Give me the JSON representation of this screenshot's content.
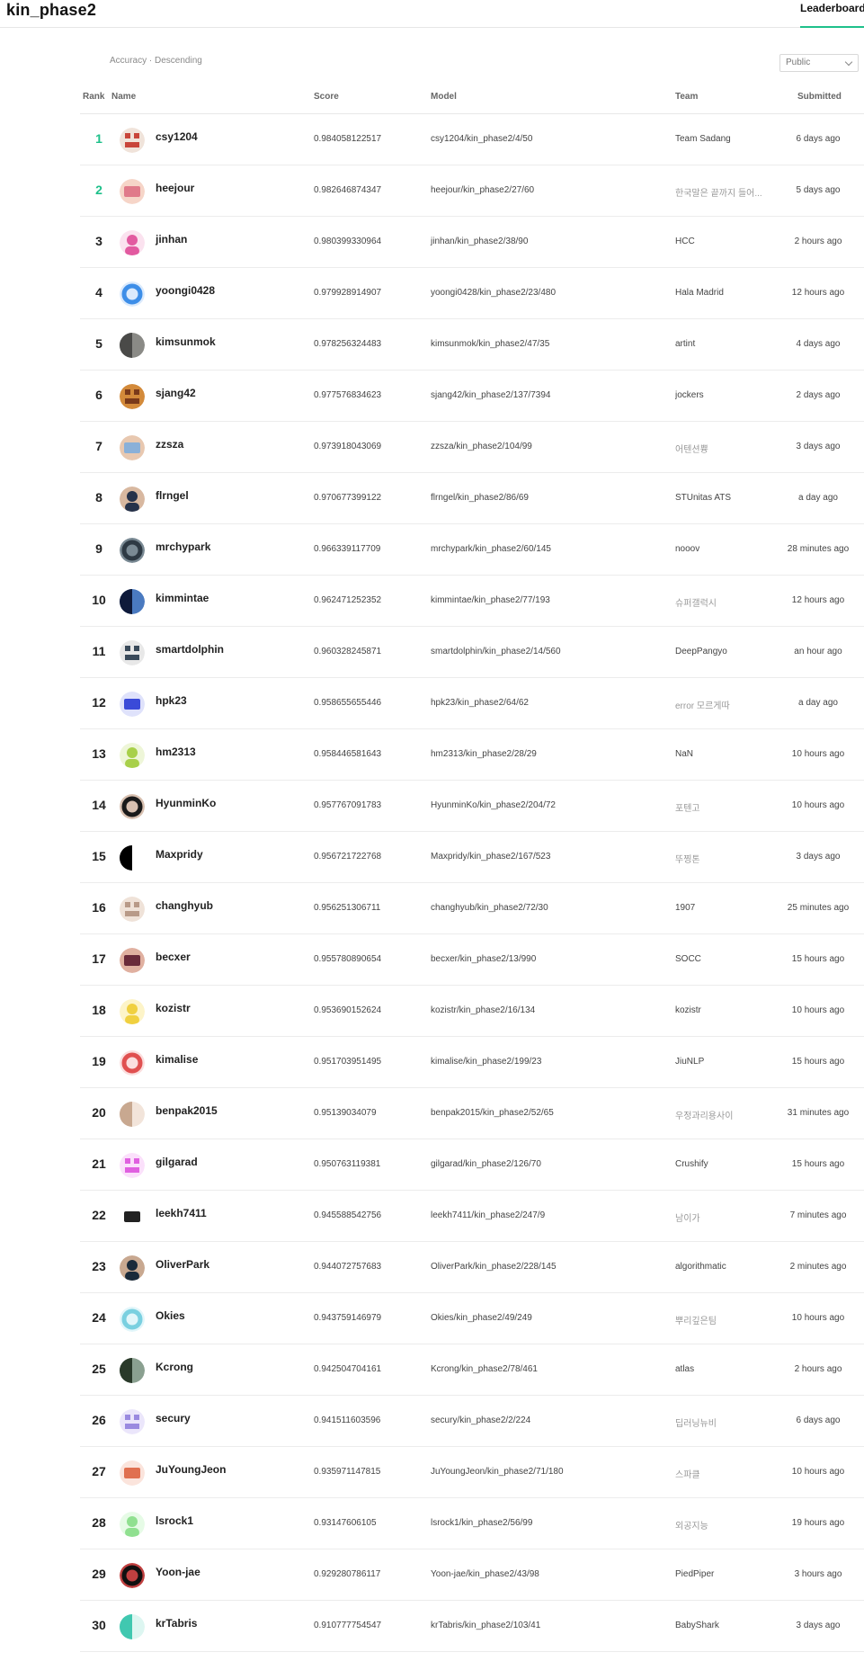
{
  "header": {
    "title": "kin_phase2",
    "tab_label": "Leaderboard",
    "accent": "#1ec08a"
  },
  "controls": {
    "sort_label": "Accuracy · Descending",
    "visibility_selected": "Public"
  },
  "table": {
    "columns": {
      "rank": "Rank",
      "name": "Name",
      "score": "Score",
      "model": "Model",
      "team": "Team",
      "submitted": "Submitted"
    },
    "rows": [
      {
        "rank": "1",
        "name": "csy1204",
        "score": "0.984058122517",
        "model": "csy1204/kin_phase2/4/50",
        "team": "Team Sadang",
        "submitted": "6 days ago",
        "avatar": [
          "#c8453a",
          "#f0e3da"
        ]
      },
      {
        "rank": "2",
        "name": "heejour",
        "score": "0.982646874347",
        "model": "heejour/kin_phase2/27/60",
        "team": "한국말은 끝까지 들어...",
        "submitted": "5 days ago",
        "avatar": [
          "#e07a8a",
          "#f6d5c8"
        ]
      },
      {
        "rank": "3",
        "name": "jinhan",
        "score": "0.980399330964",
        "model": "jinhan/kin_phase2/38/90",
        "team": "HCC",
        "submitted": "2 hours ago",
        "avatar": [
          "#e25aa0",
          "#fbe2ef"
        ]
      },
      {
        "rank": "4",
        "name": "yoongi0428",
        "score": "0.979928914907",
        "model": "yoongi0428/kin_phase2/23/480",
        "team": "Hala Madrid",
        "submitted": "12 hours ago",
        "avatar": [
          "#3d8ee8",
          "#dbeafc"
        ]
      },
      {
        "rank": "5",
        "name": "kimsunmok",
        "score": "0.978256324483",
        "model": "kimsunmok/kin_phase2/47/35",
        "team": "artint",
        "submitted": "4 days ago",
        "avatar": [
          "#4a4a48",
          "#8a8a86"
        ]
      },
      {
        "rank": "6",
        "name": "sjang42",
        "score": "0.977576834623",
        "model": "sjang42/kin_phase2/137/7394",
        "team": "jockers",
        "submitted": "2 days ago",
        "avatar": [
          "#7a3a1a",
          "#d38a3a"
        ]
      },
      {
        "rank": "7",
        "name": "zzsza",
        "score": "0.973918043069",
        "model": "zzsza/kin_phase2/104/99",
        "team": "어텐션쁑",
        "submitted": "3 days ago",
        "avatar": [
          "#8ab0d8",
          "#e8c8b0"
        ]
      },
      {
        "rank": "8",
        "name": "flrngel",
        "score": "0.970677399122",
        "model": "flrngel/kin_phase2/86/69",
        "team": "STUnitas ATS",
        "submitted": "a day ago",
        "avatar": [
          "#26324a",
          "#d8b8a0"
        ]
      },
      {
        "rank": "9",
        "name": "mrchypark",
        "score": "0.966339117709",
        "model": "mrchypark/kin_phase2/60/145",
        "team": "nooov",
        "submitted": "28 minutes ago",
        "avatar": [
          "#2e3a44",
          "#7a8a94"
        ]
      },
      {
        "rank": "10",
        "name": "kimmintae",
        "score": "0.962471252352",
        "model": "kimmintae/kin_phase2/77/193",
        "team": "슈퍼갤럭시",
        "submitted": "12 hours ago",
        "avatar": [
          "#0e1a3a",
          "#4a7ac0"
        ]
      },
      {
        "rank": "11",
        "name": "smartdolphin",
        "score": "0.960328245871",
        "model": "smartdolphin/kin_phase2/14/560",
        "team": "DeepPangyo",
        "submitted": "an hour ago",
        "avatar": [
          "#3a4a5a",
          "#e8e8e8"
        ]
      },
      {
        "rank": "12",
        "name": "hpk23",
        "score": "0.958655655446",
        "model": "hpk23/kin_phase2/64/62",
        "team": "error 모르게따",
        "submitted": "a day ago",
        "avatar": [
          "#3a4ad8",
          "#dfe2fb"
        ]
      },
      {
        "rank": "13",
        "name": "hm2313",
        "score": "0.958446581643",
        "model": "hm2313/kin_phase2/28/29",
        "team": "NaN",
        "submitted": "10 hours ago",
        "avatar": [
          "#a8d04a",
          "#eef6d8"
        ]
      },
      {
        "rank": "14",
        "name": "HyunminKo",
        "score": "0.957767091783",
        "model": "HyunminKo/kin_phase2/204/72",
        "team": "포텐고",
        "submitted": "10 hours ago",
        "avatar": [
          "#1a1a1a",
          "#d8c0b0"
        ]
      },
      {
        "rank": "15",
        "name": "Maxpridy",
        "score": "0.956721722768",
        "model": "Maxpridy/kin_phase2/167/523",
        "team": "뚜찡톤",
        "submitted": "3 days ago",
        "avatar": [
          "#000000",
          "#ffffff"
        ]
      },
      {
        "rank": "16",
        "name": "changhyub",
        "score": "0.956251306711",
        "model": "changhyub/kin_phase2/72/30",
        "team": "1907",
        "submitted": "25 minutes ago",
        "avatar": [
          "#b89a88",
          "#efe2d8"
        ]
      },
      {
        "rank": "17",
        "name": "becxer",
        "score": "0.955780890654",
        "model": "becxer/kin_phase2/13/990",
        "team": "SOCC",
        "submitted": "15 hours ago",
        "avatar": [
          "#6a2a3a",
          "#e0b0a0"
        ]
      },
      {
        "rank": "18",
        "name": "kozistr",
        "score": "0.953690152624",
        "model": "kozistr/kin_phase2/16/134",
        "team": "kozistr",
        "submitted": "10 hours ago",
        "avatar": [
          "#f0d040",
          "#fdf4c8"
        ]
      },
      {
        "rank": "19",
        "name": "kimalise",
        "score": "0.951703951495",
        "model": "kimalise/kin_phase2/199/23",
        "team": "JiuNLP",
        "submitted": "15 hours ago",
        "avatar": [
          "#e05050",
          "#fbdede"
        ]
      },
      {
        "rank": "20",
        "name": "benpak2015",
        "score": "0.95139034079",
        "model": "benpak2015/kin_phase2/52/65",
        "team": "우정과리용사이",
        "submitted": "31 minutes ago",
        "avatar": [
          "#c8a890",
          "#f2e4da"
        ]
      },
      {
        "rank": "21",
        "name": "gilgarad",
        "score": "0.950763119381",
        "model": "gilgarad/kin_phase2/126/70",
        "team": "Crushify",
        "submitted": "15 hours ago",
        "avatar": [
          "#e060e0",
          "#fbe0fb"
        ]
      },
      {
        "rank": "22",
        "name": "leekh7411",
        "score": "0.945588542756",
        "model": "leekh7411/kin_phase2/247/9",
        "team": "남이가",
        "submitted": "7 minutes ago",
        "avatar": [
          "#222222",
          "#ffffff"
        ]
      },
      {
        "rank": "23",
        "name": "OliverPark",
        "score": "0.944072757683",
        "model": "OliverPark/kin_phase2/228/145",
        "team": "algorithmatic",
        "submitted": "2 minutes ago",
        "avatar": [
          "#1a2a3a",
          "#c8a890"
        ]
      },
      {
        "rank": "24",
        "name": "Okies",
        "score": "0.943759146979",
        "model": "Okies/kin_phase2/49/249",
        "team": "뿌리깊은팀",
        "submitted": "10 hours ago",
        "avatar": [
          "#7ad0e0",
          "#e2f6fa"
        ]
      },
      {
        "rank": "25",
        "name": "Kcrong",
        "score": "0.942504704161",
        "model": "Kcrong/kin_phase2/78/461",
        "team": "atlas",
        "submitted": "2 hours ago",
        "avatar": [
          "#2a3a2a",
          "#8aa090"
        ]
      },
      {
        "rank": "26",
        "name": "secury",
        "score": "0.941511603596",
        "model": "secury/kin_phase2/2/224",
        "team": "딥러닝뉴비",
        "submitted": "6 days ago",
        "avatar": [
          "#9a8ae0",
          "#ebe6fb"
        ]
      },
      {
        "rank": "27",
        "name": "JuYoungJeon",
        "score": "0.935971147815",
        "model": "JuYoungJeon/kin_phase2/71/180",
        "team": "스파클",
        "submitted": "10 hours ago",
        "avatar": [
          "#e07050",
          "#fbe4dc"
        ]
      },
      {
        "rank": "28",
        "name": "lsrock1",
        "score": "0.93147606105",
        "model": "lsrock1/kin_phase2/56/99",
        "team": "외공지능",
        "submitted": "19 hours ago",
        "avatar": [
          "#90e090",
          "#e6fbe6"
        ]
      },
      {
        "rank": "29",
        "name": "Yoon-jae",
        "score": "0.929280786117",
        "model": "Yoon-jae/kin_phase2/43/98",
        "team": "PiedPiper",
        "submitted": "3 hours ago",
        "avatar": [
          "#101010",
          "#c04040"
        ]
      },
      {
        "rank": "30",
        "name": "krTabris",
        "score": "0.910777754547",
        "model": "krTabris/kin_phase2/103/41",
        "team": "BabyShark",
        "submitted": "3 days ago",
        "avatar": [
          "#40c8b0",
          "#ddf6f1"
        ]
      }
    ]
  }
}
